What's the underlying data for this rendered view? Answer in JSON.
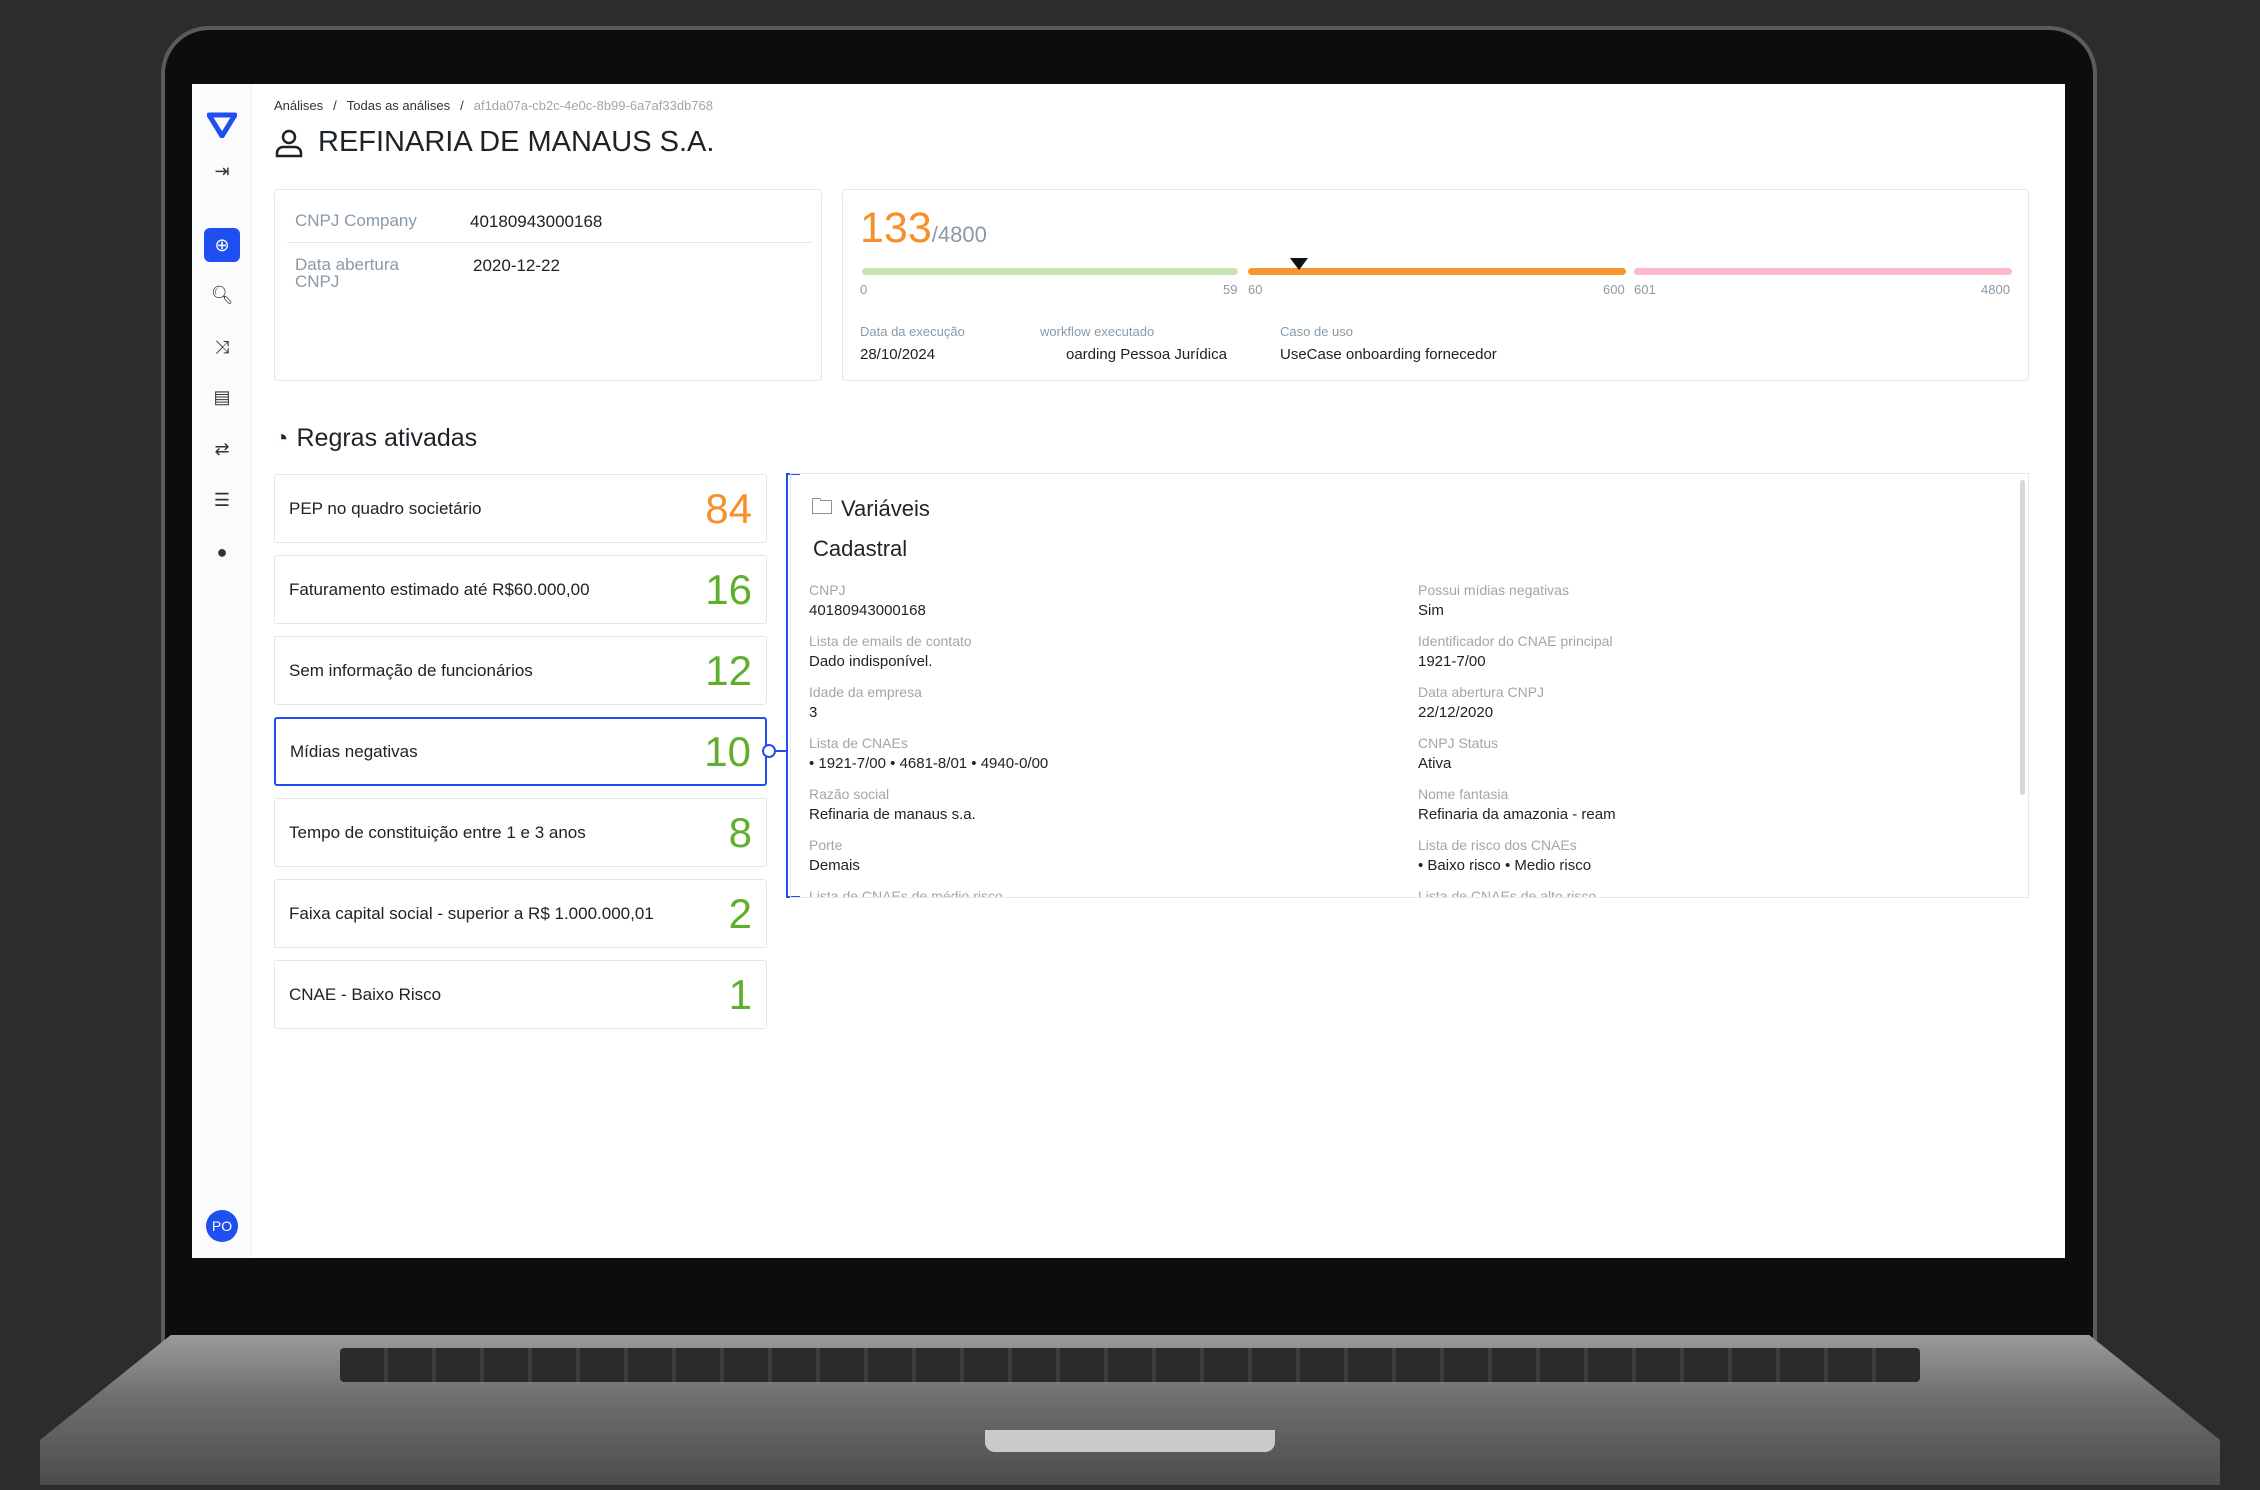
{
  "breadcrumb": [
    "Análises",
    "Todas as análises",
    "af1da07a-cb2c-4e0c-8b99-6a7af33db768"
  ],
  "title": "REFINARIA DE MANAUS S.A.",
  "company": {
    "cnpj_label": "CNPJ Company",
    "cnpj": "40180943000168",
    "date_label": "Data abertura CNPJ",
    "date": "2020-12-22"
  },
  "score": {
    "value": "133",
    "max": "/4800",
    "marker_value": 133,
    "ranges": [
      {
        "from": "0",
        "to": "59",
        "color": "#cbe3b0"
      },
      {
        "from": "60",
        "to": "600",
        "color": "#f7962f"
      },
      {
        "from": "601",
        "to": "4800",
        "color": "#fdb8cb"
      }
    ],
    "meta": [
      {
        "label": "Data da execução",
        "value": "28/10/2024"
      },
      {
        "label": "workflow executado",
        "value": "oarding Pessoa Jurídica"
      },
      {
        "label": "Caso de uso",
        "value": "UseCase onboarding fornecedor"
      }
    ]
  },
  "rules_title": "Regras ativadas",
  "rules": [
    {
      "label": "PEP no quadro societário",
      "score": "84",
      "color": "#f7902a"
    },
    {
      "label": "Faturamento estimado até R$60.000,00",
      "score": "16",
      "color": "#5fae2e"
    },
    {
      "label": "Sem informação de funcionários",
      "score": "12",
      "color": "#5fae2e"
    },
    {
      "label": "Mídias negativas",
      "score": "10",
      "color": "#5fae2e"
    },
    {
      "label": "Tempo de constituição entre 1 e 3 anos",
      "score": "8",
      "color": "#5fae2e"
    },
    {
      "label": "Faixa capital social - superior a R$ 1.000.000,01",
      "score": "2",
      "color": "#5fae2e"
    },
    {
      "label": "CNAE - Baixo Risco",
      "score": "1",
      "color": "#5fae2e"
    }
  ],
  "variables": {
    "title": "Variáveis",
    "section": "Cadastral",
    "left": [
      {
        "label": "CNPJ",
        "value": "40180943000168"
      },
      {
        "label": "Lista de emails de contato",
        "value": "Dado indisponível."
      },
      {
        "label": "Idade da empresa",
        "value": "3"
      },
      {
        "label": "Lista de CNAEs",
        "value": "•  1921-7/00   •  4681-8/01   •  4940-0/00"
      },
      {
        "label": "Razão social",
        "value": "Refinaria de manaus s.a."
      },
      {
        "label": "Porte",
        "value": "Demais"
      },
      {
        "label": "Lista de CNAEs de médio risco",
        "value": ""
      }
    ],
    "right": [
      {
        "label": "Possui mídias negativas",
        "value": "Sim"
      },
      {
        "label": "Identificador do CNAE principal",
        "value": "1921-7/00"
      },
      {
        "label": "Data abertura CNPJ",
        "value": "22/12/2020"
      },
      {
        "label": "CNPJ Status",
        "value": "Ativa"
      },
      {
        "label": "Nome fantasia",
        "value": "Refinaria da amazonia - ream"
      },
      {
        "label": "Lista de risco dos CNAEs",
        "value": "•  Baixo risco   •  Medio risco"
      },
      {
        "label": "Lista de CNAEs de alto risco",
        "value": ""
      }
    ]
  },
  "user": {
    "initials": "PO"
  }
}
